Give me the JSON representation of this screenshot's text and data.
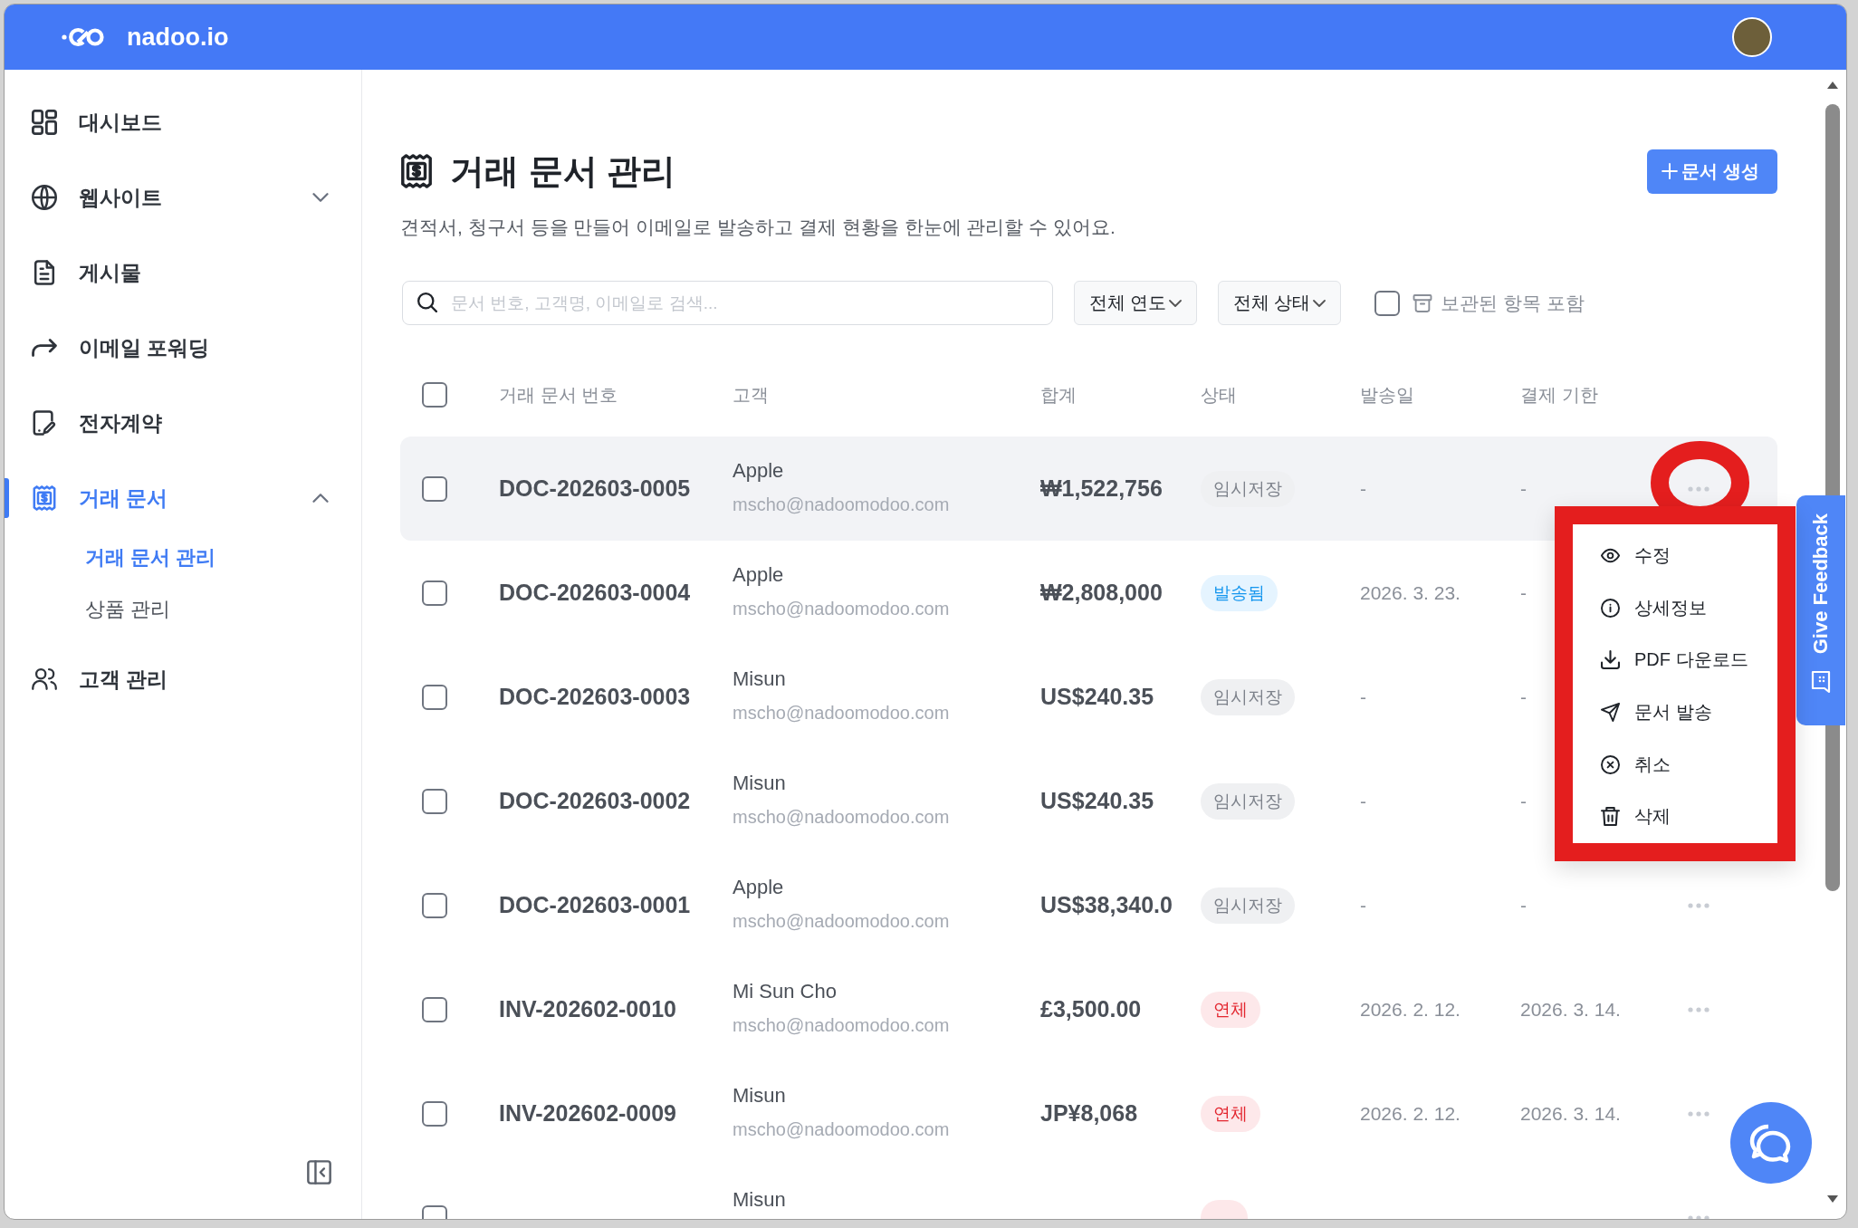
{
  "header": {
    "brand": "nadoo.io"
  },
  "sidebar": {
    "items": [
      {
        "label": "대시보드",
        "selected": false
      },
      {
        "label": "웹사이트",
        "selected": false,
        "expanded": false
      },
      {
        "label": "게시물",
        "selected": false
      },
      {
        "label": "이메일 포워딩",
        "selected": false
      },
      {
        "label": "전자계약",
        "selected": false
      },
      {
        "label": "거래 문서",
        "selected": true,
        "expanded": true,
        "children": [
          {
            "label": "거래 문서 관리",
            "selected": true
          },
          {
            "label": "상품 관리",
            "selected": false
          }
        ]
      },
      {
        "label": "고객 관리",
        "selected": false
      }
    ]
  },
  "page": {
    "title": "거래 문서 관리",
    "subtitle": "견적서, 청구서 등을 만들어 이메일로 발송하고 결제 현황을 한눈에 관리할 수 있어요.",
    "create_button": "문서 생성"
  },
  "filters": {
    "search": {
      "placeholder": "문서 번호, 고객명, 이메일로 검색..."
    },
    "dropdowns": [
      {
        "label": "전체 연도"
      },
      {
        "label": "전체 상태"
      }
    ],
    "include_archived": {
      "label": "보관된 항목 포함",
      "checked": false
    }
  },
  "table": {
    "select_all": {
      "checked": false
    },
    "columns": [
      "거래 문서 번호",
      "고객",
      "합계",
      "상태",
      "발송일",
      "결제 기한"
    ],
    "rows": [
      {
        "number": "DOC-202603-0005",
        "customer": "Apple",
        "email": "mscho@nadoomodoo.com",
        "total": "₩1,522,756",
        "status": {
          "label": "임시저장",
          "kind": "draft"
        },
        "sent": "-",
        "due": "-",
        "checked": false,
        "highlighted": true,
        "menu_open": true
      },
      {
        "number": "DOC-202603-0004",
        "customer": "Apple",
        "email": "mscho@nadoomodoo.com",
        "total": "₩2,808,000",
        "status": {
          "label": "발송됨",
          "kind": "sent"
        },
        "sent": "2026. 3. 23.",
        "due": "-",
        "checked": false,
        "highlighted": false,
        "menu_open": false
      },
      {
        "number": "DOC-202603-0003",
        "customer": "Misun",
        "email": "mscho@nadoomodoo.com",
        "total": "US$240.35",
        "status": {
          "label": "임시저장",
          "kind": "draft"
        },
        "sent": "-",
        "due": "-",
        "checked": false,
        "highlighted": false,
        "menu_open": false
      },
      {
        "number": "DOC-202603-0002",
        "customer": "Misun",
        "email": "mscho@nadoomodoo.com",
        "total": "US$240.35",
        "status": {
          "label": "임시저장",
          "kind": "draft"
        },
        "sent": "-",
        "due": "-",
        "checked": false,
        "highlighted": false,
        "menu_open": false
      },
      {
        "number": "DOC-202603-0001",
        "customer": "Apple",
        "email": "mscho@nadoomodoo.com",
        "total": "US$38,340.0",
        "status": {
          "label": "임시저장",
          "kind": "draft"
        },
        "sent": "-",
        "due": "-",
        "checked": false,
        "highlighted": false,
        "menu_open": false
      },
      {
        "number": "INV-202602-0010",
        "customer": "Mi Sun Cho",
        "email": "mscho@nadoomodoo.com",
        "total": "£3,500.00",
        "status": {
          "label": "연체",
          "kind": "overdue"
        },
        "sent": "2026. 2. 12.",
        "due": "2026. 3. 14.",
        "checked": false,
        "highlighted": false,
        "menu_open": false
      },
      {
        "number": "INV-202602-0009",
        "customer": "Misun",
        "email": "mscho@nadoomodoo.com",
        "total": "JP¥8,068",
        "status": {
          "label": "연체",
          "kind": "overdue"
        },
        "sent": "2026. 2. 12.",
        "due": "2026. 3. 14.",
        "checked": false,
        "highlighted": false,
        "menu_open": false
      },
      {
        "customer": "Misun",
        "status": {
          "kind": "overdue"
        },
        "checked": false,
        "highlighted": false,
        "menu_open": false
      }
    ]
  },
  "row_menu": {
    "items": [
      {
        "label": "수정"
      },
      {
        "label": "상세정보"
      },
      {
        "label": "PDF 다운로드"
      },
      {
        "label": "문서 발송"
      },
      {
        "label": "취소"
      },
      {
        "label": "삭제"
      }
    ]
  },
  "feedback_tab": {
    "label": "Give Feedback"
  }
}
